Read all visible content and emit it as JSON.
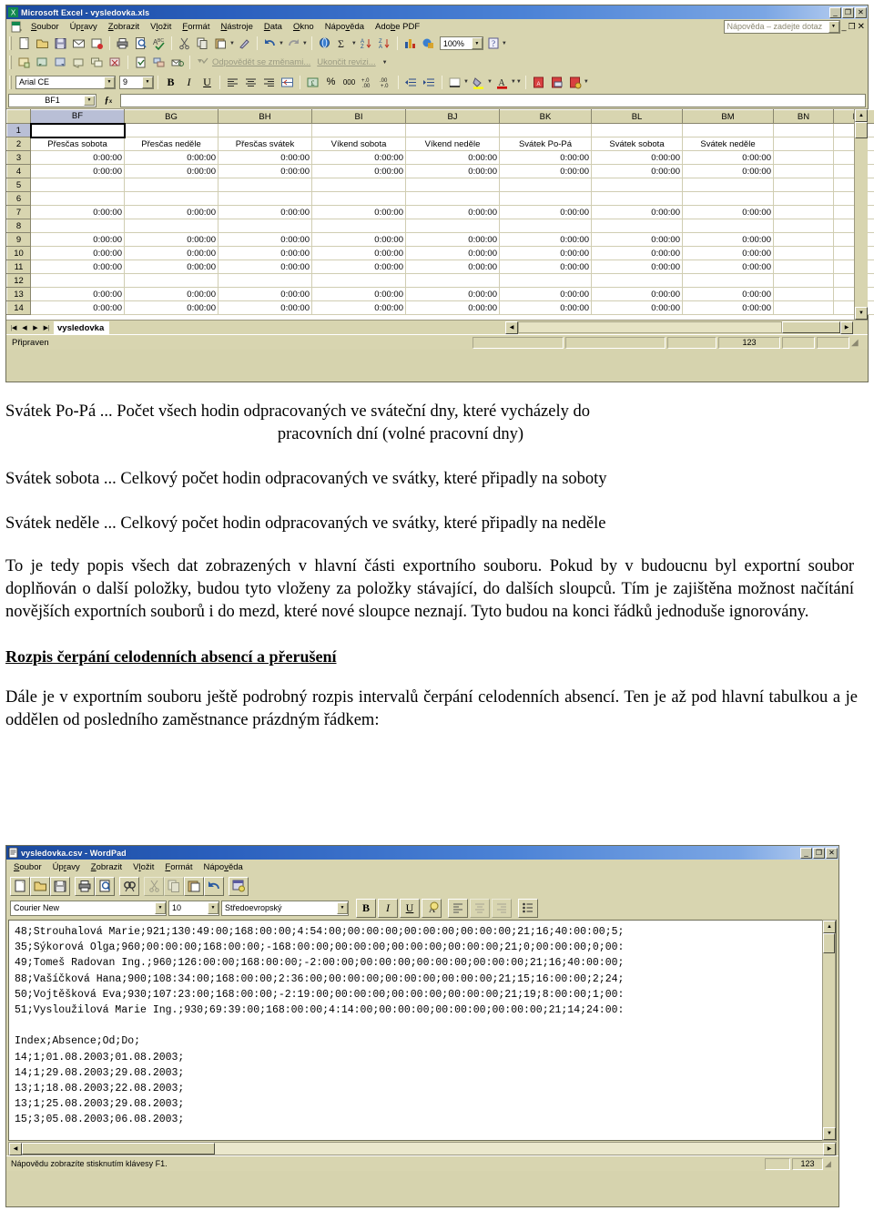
{
  "excel": {
    "title": "Microsoft Excel - vysledovka.xls",
    "title_icon": "excel-icon",
    "menu": [
      "Soubor",
      "Úpravy",
      "Zobrazit",
      "Vložit",
      "Formát",
      "Nástroje",
      "Data",
      "Okno",
      "Nápověda",
      "Adobe PDF"
    ],
    "ask_box_placeholder": "Nápověda – zadejte dotaz",
    "zoom": "100%",
    "font_name": "Arial CE",
    "font_size": "9",
    "reviewing": {
      "respond": "Odpovědět se změnami...",
      "end": "Ukončit revizi..."
    },
    "namebox": "BF1",
    "formula": "",
    "columns": [
      "BF",
      "BG",
      "BH",
      "BI",
      "BJ",
      "BK",
      "BL",
      "BM",
      "BN",
      "BO"
    ],
    "selected_column": "BF",
    "selected_row": "1",
    "header_row_index": 2,
    "headers": [
      "Přesčas sobota",
      "Přesčas neděle",
      "Přesčas svátek",
      "Víkend sobota",
      "Víkend neděle",
      "Svátek Po-Pá",
      "Svátek sobota",
      "Svátek neděle",
      "",
      ""
    ],
    "time_zero": "0:00:00",
    "rows": [
      {
        "num": "1",
        "filled": false
      },
      {
        "num": "2",
        "filled": false
      },
      {
        "num": "3",
        "filled": true
      },
      {
        "num": "4",
        "filled": true
      },
      {
        "num": "5",
        "filled": false
      },
      {
        "num": "6",
        "filled": false
      },
      {
        "num": "7",
        "filled": true
      },
      {
        "num": "8",
        "filled": false
      },
      {
        "num": "9",
        "filled": true
      },
      {
        "num": "10",
        "filled": true
      },
      {
        "num": "11",
        "filled": true
      },
      {
        "num": "12",
        "filled": false
      },
      {
        "num": "13",
        "filled": true
      },
      {
        "num": "14",
        "filled": true
      }
    ],
    "sheet_tab": "vysledovka",
    "status": "Připraven",
    "status_indicator": "123"
  },
  "document": {
    "lines": [
      {
        "text": "Svátek Po-Pá ... Počet všech hodin odpracovaných ve sváteční dny, které vycházely do",
        "align": "left"
      },
      {
        "text": "pracovních dní (volné pracovní dny)",
        "align": "center"
      }
    ],
    "line_sobota": "Svátek sobota ... Celkový počet hodin odpracovaných ve svátky, které připadly na soboty",
    "line_nedele": "Svátek neděle ... Celkový počet hodin odpracovaných ve svátky, které připadly na neděle",
    "paragraph1": "To je tedy popis všech dat zobrazených v hlavní části exportního souboru. Pokud by v budoucnu byl exportní soubor doplňován o další položky, budou tyto vloženy za položky stávající, do dalších sloupců. Tím je zajištěna možnost načítání novějších exportních souborů i do mezd, které nové sloupce neznají. Tyto budou na konci řádků jednoduše ignorovány.",
    "heading": "Rozpis čerpání celodenních absencí a  přerušení",
    "paragraph2": "Dále je v exportním souboru ještě podrobný rozpis intervalů čerpání celodenních absencí. Ten je až pod hlavní tabulkou a je oddělen od posledního zaměstnance prázdným řádkem:"
  },
  "wordpad": {
    "title": "vysledovka.csv - WordPad",
    "title_icon": "wordpad-icon",
    "menu": [
      "Soubor",
      "Úpravy",
      "Zobrazit",
      "Vložit",
      "Formát",
      "Nápověda"
    ],
    "font_name": "Courier New",
    "font_size": "10",
    "charset": "Středoevropský",
    "bold_label": "B",
    "italic_label": "I",
    "underline_label": "U",
    "content": "48;Strouhalová Marie;921;130:49:00;168:00:00;4:54:00;00:00:00;00:00:00;00:00:00;21;16;40:00:00;5;\n35;Sýkorová Olga;960;00:00:00;168:00:00;-168:00:00;00:00:00;00:00:00;00:00:00;21;0;00:00:00;0;00:\n49;Tomeš Radovan Ing.;960;126:00:00;168:00:00;-2:00:00;00:00:00;00:00:00;00:00:00;21;16;40:00:00;\n88;Vašíčková Hana;900;108:34:00;168:00:00;2:36:00;00:00:00;00:00:00;00:00:00;21;15;16:00:00;2;24;\n50;Vojtěšková Eva;930;107:23:00;168:00:00;-2:19:00;00:00:00;00:00:00;00:00:00;21;19;8:00:00;1;00:\n51;Vysloužilová Marie Ing.;930;69:39:00;168:00:00;4:14:00;00:00:00;00:00:00;00:00:00;21;14;24:00:\n\nIndex;Absence;Od;Do;\n14;1;01.08.2003;01.08.2003;\n14;1;29.08.2003;29.08.2003;\n13;1;18.08.2003;22.08.2003;\n13;1;25.08.2003;29.08.2003;\n15;3;05.08.2003;06.08.2003;",
    "status": "Nápovědu zobrazíte stisknutím klávesy F1.",
    "status_indicator": "123"
  },
  "colors": {
    "chrome": "#d8d5b0",
    "title_start": "#1b4a9e",
    "title_end": "#c3d6f2",
    "selection": "#b9bfd6",
    "grid_line": "#d0cdb2"
  }
}
